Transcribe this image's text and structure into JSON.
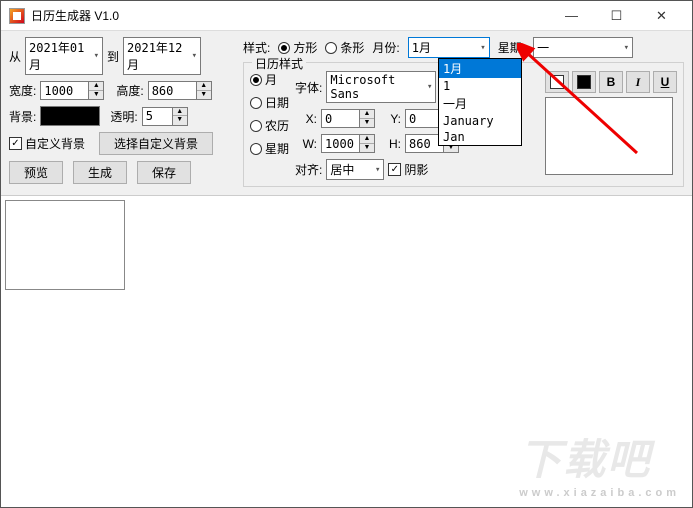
{
  "window": {
    "title": "日历生成器 V1.0"
  },
  "date": {
    "from_label": "从",
    "from_value": "2021年01月",
    "to_label": "到",
    "to_value": "2021年12月"
  },
  "size": {
    "width_label": "宽度:",
    "width_value": "1000",
    "height_label": "高度:",
    "height_value": "860"
  },
  "bg": {
    "label": "背景:",
    "color": "#000000",
    "opacity_label": "透明:",
    "opacity_value": "5"
  },
  "custombg": {
    "check_label": "自定义背景",
    "checked": true,
    "button": "选择自定义背景"
  },
  "actions": {
    "preview": "预览",
    "generate": "生成",
    "save": "保存"
  },
  "style": {
    "label": "样式:",
    "square": "方形",
    "square_sel": true,
    "bar": "条形",
    "bar_sel": false,
    "month_label": "月份:",
    "month_value": "1月",
    "month_options": [
      "1月",
      "1",
      "一月",
      "January",
      "Jan"
    ],
    "week_label": "星期:",
    "week_value": "一"
  },
  "calgroup": {
    "title": "日历样式",
    "items": [
      {
        "label": "月",
        "sel": true
      },
      {
        "label": "日期",
        "sel": false
      },
      {
        "label": "农历",
        "sel": false
      },
      {
        "label": "星期",
        "sel": false
      }
    ],
    "font_label": "字体:",
    "font_value": "Microsoft Sans",
    "x_label": "X:",
    "x_value": "0",
    "y_label": "Y:",
    "y_value": "0",
    "w_label": "W:",
    "w_value": "1000",
    "h_label": "H:",
    "h_value": "860",
    "align_label": "对齐:",
    "align_value": "居中",
    "shadow_label": "阴影",
    "shadow_checked": true,
    "bold": "B",
    "italic": "I",
    "underline": "U",
    "color1": "#ffffff",
    "color2": "#000000"
  },
  "watermark": {
    "main": "下载吧",
    "sub": "www.xiazaiba.com"
  }
}
